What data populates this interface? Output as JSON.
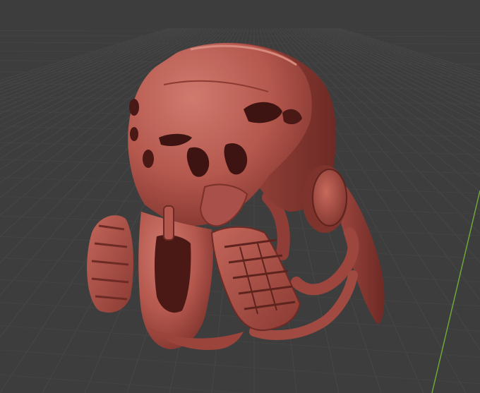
{
  "viewport": {
    "background_color": "#3d3d3d",
    "grid_color": "#474747",
    "grid_minor_color": "#434343",
    "y_axis_color": "#6fa53a",
    "object": {
      "name": "",
      "icon": "helmet-mesh-icon",
      "base_color": "#b4574d",
      "shadow_color": "#6e2a25",
      "highlight_color": "#d07a6e",
      "dark_color": "#4a1915"
    }
  }
}
